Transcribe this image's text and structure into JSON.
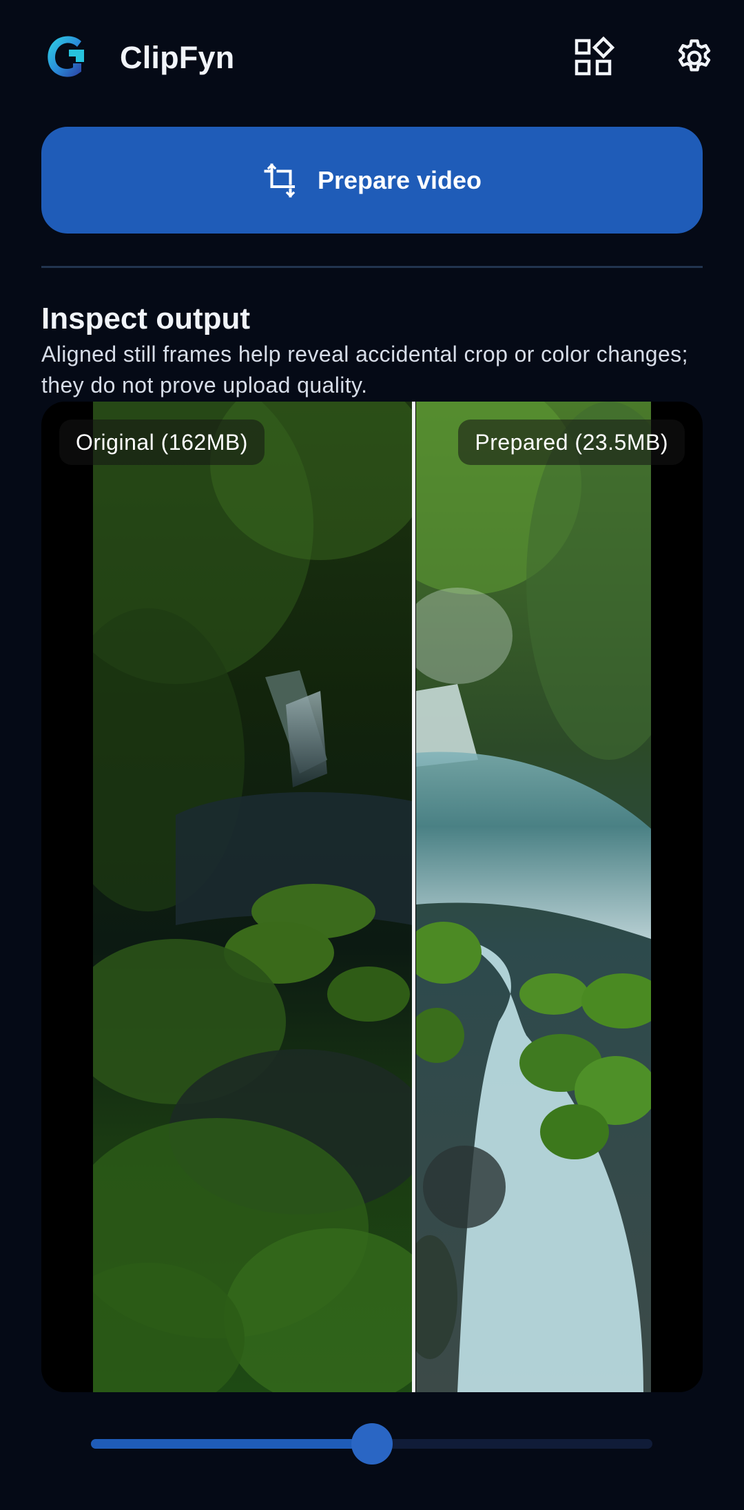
{
  "app": {
    "title": "ClipFyn",
    "logo_icon": "clipfyn-logo",
    "header_icons": [
      "apps-grid-icon",
      "gear-icon"
    ]
  },
  "prepare": {
    "label": "Prepare video",
    "icon": "crop-icon"
  },
  "inspect": {
    "title": "Inspect output",
    "description": "Aligned still frames help reveal accidental crop or color changes; they do not prove upload quality."
  },
  "compare": {
    "original_label": "Original (162MB)",
    "prepared_label": "Prepared (23.5MB)",
    "slider_fraction": 0.5
  },
  "colors": {
    "background": "#050a16",
    "accent": "#1f5cb8",
    "divider": "#22354f",
    "slider_track": "#101c38"
  }
}
